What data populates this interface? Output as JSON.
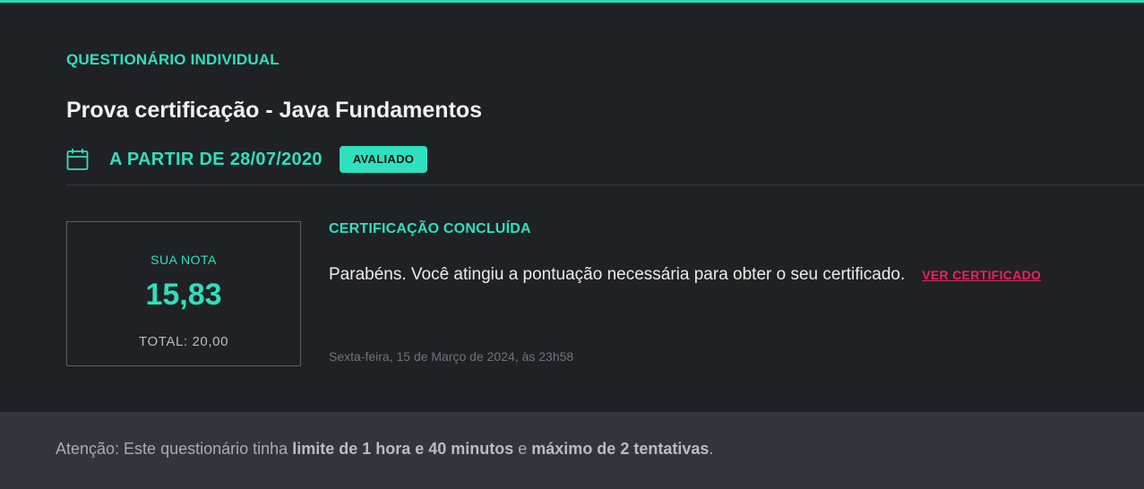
{
  "header": {
    "kicker": "QUESTIONÁRIO INDIVIDUAL",
    "title": "Prova certificação - Java Fundamentos",
    "date_label": "A PARTIR DE 28/07/2020",
    "badge": "AVALIADO",
    "date_icon": "calendar-icon"
  },
  "score": {
    "label": "SUA NOTA",
    "value": "15,83",
    "total": "TOTAL: 20,00"
  },
  "certification": {
    "title": "CERTIFICAÇÃO CONCLUÍDA",
    "message": "Parabéns. Você atingiu a pontuação necessária para obter o seu certificado.",
    "link_label": "VER CERTIFICADO",
    "timestamp": "Sexta-feira, 15 de Março de 2024, às 23h58"
  },
  "footer": {
    "prefix": "Atenção: Este questionário tinha ",
    "limit": "limite de 1 hora e 40 minutos",
    "middle": " e ",
    "attempts": "máximo de 2 tentativas",
    "suffix": "."
  },
  "colors": {
    "accent": "#2ee0bd",
    "link": "#e8225f",
    "background": "#202124",
    "footer_background": "#323539"
  }
}
